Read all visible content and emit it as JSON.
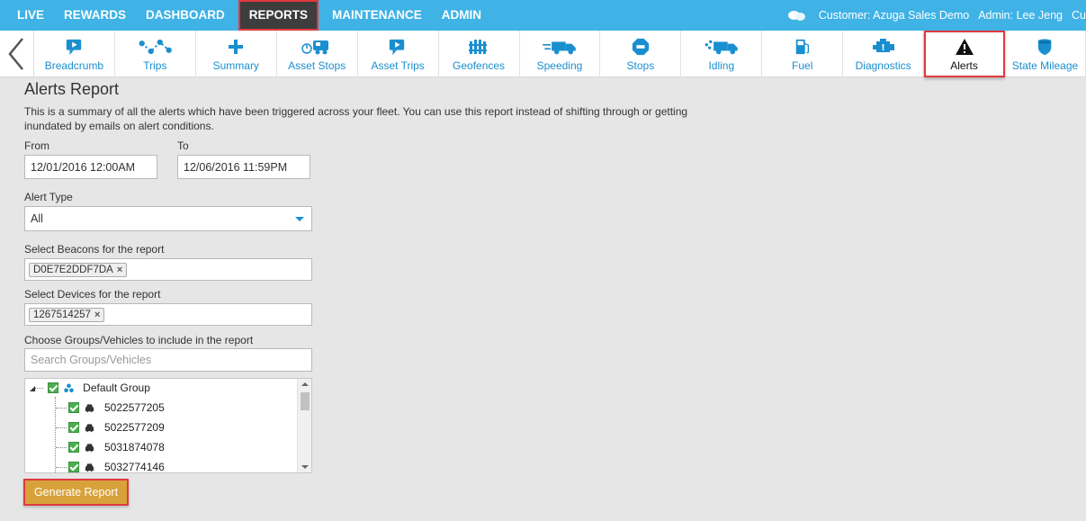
{
  "topnav": {
    "items": [
      {
        "label": "LIVE"
      },
      {
        "label": "REWARDS"
      },
      {
        "label": "DASHBOARD"
      },
      {
        "label": "REPORTS",
        "active": true
      },
      {
        "label": "MAINTENANCE"
      },
      {
        "label": "ADMIN"
      }
    ],
    "customer": "Customer: Azuga Sales Demo",
    "admin": "Admin: Lee Jeng",
    "overflow": "Cu"
  },
  "tabs": [
    {
      "label": "Breadcrumb",
      "icon": "breadcrumb-icon"
    },
    {
      "label": "Trips",
      "icon": "trips-icon"
    },
    {
      "label": "Summary",
      "icon": "plus-icon"
    },
    {
      "label": "Asset Stops",
      "icon": "trailer-icon"
    },
    {
      "label": "Asset Trips",
      "icon": "asset-trips-icon"
    },
    {
      "label": "Geofences",
      "icon": "fence-icon"
    },
    {
      "label": "Speeding",
      "icon": "speeding-truck-icon"
    },
    {
      "label": "Stops",
      "icon": "stop-hexagon-icon"
    },
    {
      "label": "Idling",
      "icon": "idling-truck-icon"
    },
    {
      "label": "Fuel",
      "icon": "fuel-pump-icon"
    },
    {
      "label": "Diagnostics",
      "icon": "engine-icon"
    },
    {
      "label": "Alerts",
      "icon": "warning-icon",
      "active": true
    },
    {
      "label": "State Mileage",
      "icon": "highway-shield-icon"
    }
  ],
  "report": {
    "title": "Alerts Report",
    "description": "This is a summary of all the alerts which have been triggered across your fleet. You can use this report instead of shifting through or getting inundated by emails on alert conditions.",
    "from_label": "From",
    "from_value": "12/01/2016 12:00AM",
    "to_label": "To",
    "to_value": "12/06/2016 11:59PM",
    "alert_type_label": "Alert Type",
    "alert_type_value": "All",
    "beacons_label": "Select Beacons for the report",
    "beacon_chip": "D0E7E2DDF7DA",
    "devices_label": "Select Devices for the report",
    "device_chip": "1267514257",
    "groups_label": "Choose Groups/Vehicles to include in the report",
    "search_placeholder": "Search Groups/Vehicles",
    "tree": {
      "group": "Default Group",
      "vehicles": [
        "5022577205",
        "5022577209",
        "5031874078",
        "5032774146"
      ]
    },
    "generate_label": "Generate Report",
    "chip_remove": "×"
  },
  "colors": {
    "nav_bg": "#3fb2e6",
    "active_nav": "#3d3d3d",
    "highlight": "#e0393e",
    "tab_text": "#1a8fcf",
    "button": "#d8a23a",
    "check": "#4caf50"
  }
}
